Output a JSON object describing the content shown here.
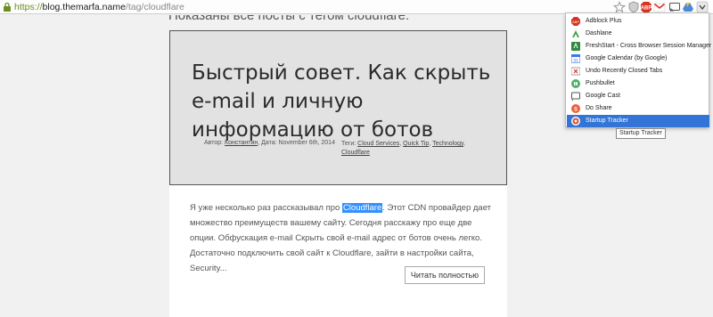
{
  "address_bar": {
    "scheme": "https://",
    "host": "blog.themarfa.name",
    "path": "/tag/cloudflare"
  },
  "page": {
    "heading": "Показаны все посты с тегом cloudflare:",
    "post": {
      "title": "Быстрый совет. Как скрыть e-mail и личную информацию от ботов",
      "meta_author_prefix": "Автор: ",
      "author": "Константин",
      "meta_date": ", Дата: November 6th, 2014",
      "tags_prefix": "Теги: ",
      "tags": [
        "Cloud Services",
        "Quick Tip",
        "Technology",
        "Cloudflare"
      ],
      "excerpt_before": "Я уже несколько раз рассказывал про ",
      "excerpt_highlight": "Cloudflare",
      "excerpt_after": ". Этот CDN провайдер дает множество преимуществ вашему сайту. Сегодня расскажу про еще две опции. Обфускация e-mail Скрыть свой e-mail адрес от ботов очень легко. Достаточно подключить свой сайт к Cloudflare, зайти в настройки сайта, Security...",
      "read_more": "Читать полностью"
    }
  },
  "extensions_menu": {
    "items": [
      {
        "label": "Adblock Plus",
        "icon": "adblock-plus-icon",
        "color": "#d9321f"
      },
      {
        "label": "Dashlane",
        "icon": "dashlane-icon",
        "color": "#3aa34a"
      },
      {
        "label": "FreshStart - Cross Browser Session Manager",
        "icon": "freshstart-icon",
        "color": "#2e8b3a"
      },
      {
        "label": "Google Calendar (by Google)",
        "icon": "google-calendar-icon",
        "color": "#3b78e7"
      },
      {
        "label": "Undo Recently Closed Tabs",
        "icon": "undo-tabs-icon",
        "color": "#d33"
      },
      {
        "label": "Pushbullet",
        "icon": "pushbullet-icon",
        "color": "#4ab367"
      },
      {
        "label": "Google Cast",
        "icon": "google-cast-icon",
        "color": "#555"
      },
      {
        "label": "Do Share",
        "icon": "do-share-icon",
        "color": "#e8613c"
      },
      {
        "label": "Startup Tracker",
        "icon": "startup-tracker-icon",
        "color": "#e04a2a",
        "selected": true
      }
    ],
    "tooltip": "Startup Tracker"
  },
  "colors": {
    "selection_highlight": "#3390ff",
    "menu_selected": "#3375d6",
    "scheme_green": "#6b8e23"
  }
}
